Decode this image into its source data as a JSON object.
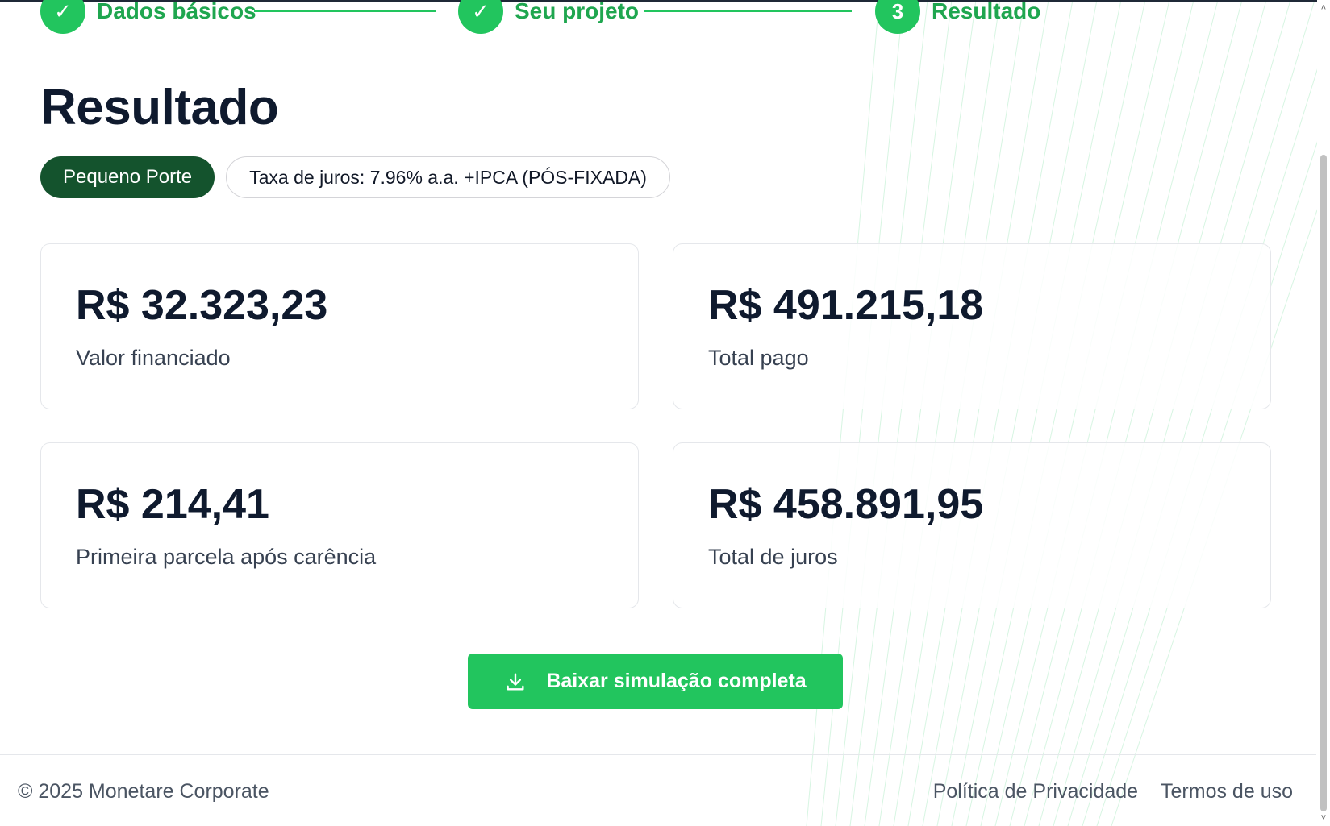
{
  "stepper": {
    "steps": [
      {
        "marker": "✓",
        "label": "Dados básicos"
      },
      {
        "marker": "✓",
        "label": "Seu projeto"
      },
      {
        "marker": "3",
        "label": "Resultado"
      }
    ]
  },
  "main": {
    "title": "Resultado",
    "tags": {
      "porte": "Pequeno Porte",
      "taxa": "Taxa de juros: 7.96% a.a. +IPCA (PÓS-FIXADA)"
    },
    "cards": [
      {
        "value": "R$ 32.323,23",
        "label": "Valor financiado"
      },
      {
        "value": "R$ 491.215,18",
        "label": "Total pago"
      },
      {
        "value": "R$ 214,41",
        "label": "Primeira parcela após carência"
      },
      {
        "value": "R$ 458.891,95",
        "label": "Total de juros"
      }
    ],
    "download_button": {
      "label": "Baixar simulação completa",
      "icon": "download-icon"
    }
  },
  "footer": {
    "copyright": "© 2025 Monetare Corporate",
    "links": [
      "Política de Privacidade",
      "Termos de uso"
    ]
  },
  "colors": {
    "accent": "#22c55e",
    "accent_dark": "#14532d",
    "step_text": "#1fa64f",
    "heading": "#0f1a2e"
  }
}
